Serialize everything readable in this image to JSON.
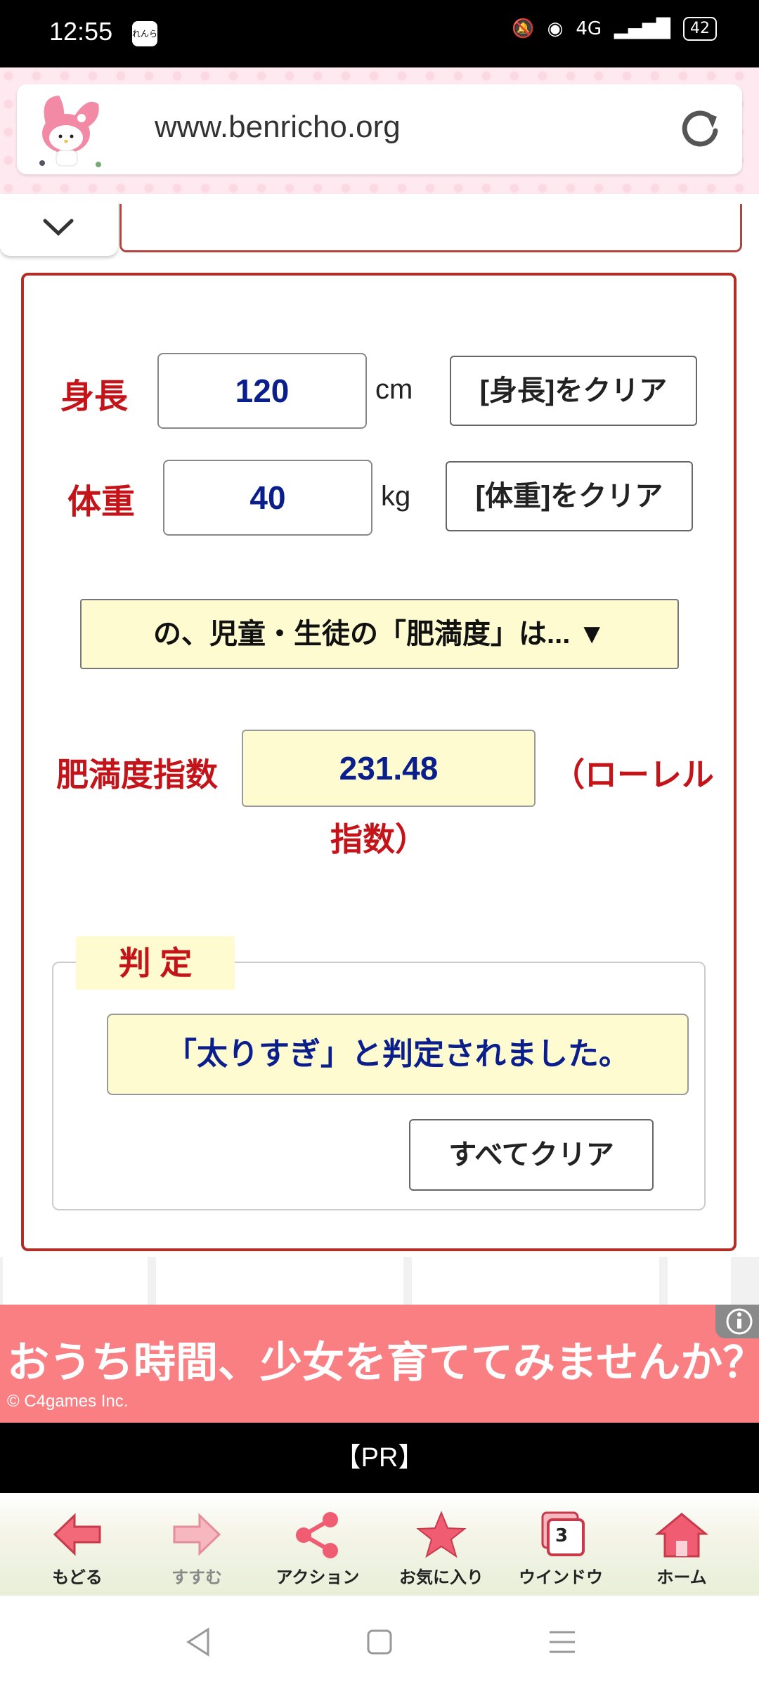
{
  "status_bar": {
    "time": "12:55",
    "badge": "れんらく",
    "network": "4G",
    "battery": "42"
  },
  "browser": {
    "url": "www.benricho.org"
  },
  "form": {
    "height_label": "身長",
    "height_value": "120",
    "height_unit": "cm",
    "height_clear": "[身長]をクリア",
    "weight_label": "体重",
    "weight_value": "40",
    "weight_unit": "kg",
    "weight_clear": "[体重]をクリア",
    "category_select": "の、児童・生徒の「肥満度」は... ▼",
    "index_label": "肥満度指数",
    "index_value": "231.48",
    "index_suffix_1": "（ローレル",
    "index_suffix_2": "指数）"
  },
  "judgement": {
    "title": "判 定",
    "result": "「太りすぎ」と判定されました。",
    "clear_all": "すべてクリア"
  },
  "ad": {
    "headline": "おうち時間、少女を育ててみませんか？",
    "copyright": "© C4games Inc.",
    "pr_label": "【PR】"
  },
  "toolbar": {
    "items": [
      {
        "label": "もどる",
        "icon": "back-arrow-icon"
      },
      {
        "label": "すすむ",
        "icon": "forward-arrow-icon"
      },
      {
        "label": "アクション",
        "icon": "share-icon"
      },
      {
        "label": "お気に入り",
        "icon": "star-icon"
      },
      {
        "label": "ウインドウ",
        "icon": "window-icon",
        "count": "3"
      },
      {
        "label": "ホーム",
        "icon": "home-icon"
      }
    ]
  },
  "colors": {
    "accent_red": "#c4141a",
    "value_blue": "#0b1f8c",
    "highlight_yellow": "#fefbd0",
    "ad_pink": "#fa7f83"
  }
}
